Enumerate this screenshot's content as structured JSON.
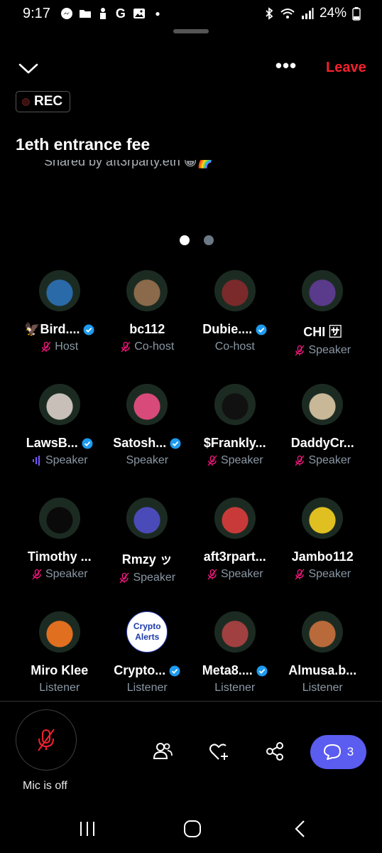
{
  "status_bar": {
    "time": "9:17",
    "battery": "24%",
    "left_icons": [
      "messenger-icon",
      "folder-icon",
      "bank-icon",
      "google-icon",
      "gallery-icon",
      "dot-icon"
    ],
    "right_icons": [
      "bluetooth-icon",
      "wifi-icon",
      "signal-icon",
      "battery-icon"
    ]
  },
  "header": {
    "leave_label": "Leave",
    "more_label": "•••"
  },
  "space": {
    "rec_label": "REC",
    "title": "1eth entrance fee",
    "shared_by": "Shared by aft3rparty.eth 😁🌈"
  },
  "pager": {
    "count": 2,
    "active_index": 0
  },
  "participants": [
    {
      "name": "🦅Bird....",
      "verified": true,
      "role": "Host",
      "role_icon": "mic-muted",
      "avatar_color": "#2a6aa8"
    },
    {
      "name": "bc112",
      "verified": false,
      "role": "Co-host",
      "role_icon": "mic-muted",
      "avatar_color": "#8a6a4a"
    },
    {
      "name": "Dubie....",
      "verified": true,
      "role": "Co-host",
      "role_icon": "none",
      "avatar_color": "#7a2a2a"
    },
    {
      "name": "CHI 🈂",
      "verified": false,
      "role": "Speaker",
      "role_icon": "mic-muted",
      "avatar_color": "#5a3a8a"
    },
    {
      "name": "LawsB...",
      "verified": true,
      "role": "Speaker",
      "role_icon": "speaking",
      "avatar_color": "#c8c0b8"
    },
    {
      "name": "Satosh...",
      "verified": true,
      "role": "Speaker",
      "role_icon": "none",
      "avatar_color": "#d84a7a"
    },
    {
      "name": "$Frankly...",
      "verified": false,
      "role": "Speaker",
      "role_icon": "mic-muted",
      "avatar_color": "#111111"
    },
    {
      "name": "DaddyCr...",
      "verified": false,
      "role": "Speaker",
      "role_icon": "mic-muted",
      "avatar_color": "#c8b898"
    },
    {
      "name": "Timothy ...",
      "verified": false,
      "role": "Speaker",
      "role_icon": "mic-muted",
      "avatar_color": "#0a0a0a"
    },
    {
      "name": "Rmzy ッ",
      "verified": false,
      "role": "Speaker",
      "role_icon": "mic-muted",
      "avatar_color": "#4a4ab8"
    },
    {
      "name": "aft3rpart...",
      "verified": false,
      "role": "Speaker",
      "role_icon": "mic-muted",
      "avatar_color": "#c83a3a"
    },
    {
      "name": "Jambo112",
      "verified": false,
      "role": "Speaker",
      "role_icon": "mic-muted",
      "avatar_color": "#e0c020"
    },
    {
      "name": "Miro Klee",
      "verified": false,
      "role": "Listener",
      "role_icon": "none",
      "avatar_color": "#e07020"
    },
    {
      "name": "Crypto...",
      "verified": true,
      "role": "Listener",
      "role_icon": "none",
      "avatar_color": "#ffffff",
      "avatar_text": "Crypto Alerts"
    },
    {
      "name": "Meta8....",
      "verified": true,
      "role": "Listener",
      "role_icon": "none",
      "avatar_color": "#a04040"
    },
    {
      "name": "Almusa.b...",
      "verified": false,
      "role": "Listener",
      "role_icon": "none",
      "avatar_color": "#b86a3a"
    }
  ],
  "controls": {
    "mic_label": "Mic is off",
    "chat_count": "3"
  },
  "colors": {
    "leave": "#f4212e",
    "verified": "#1d9bf0",
    "muted": "#f91880",
    "speaking": "#7856ff",
    "chat_button": "#5b5cf0"
  }
}
